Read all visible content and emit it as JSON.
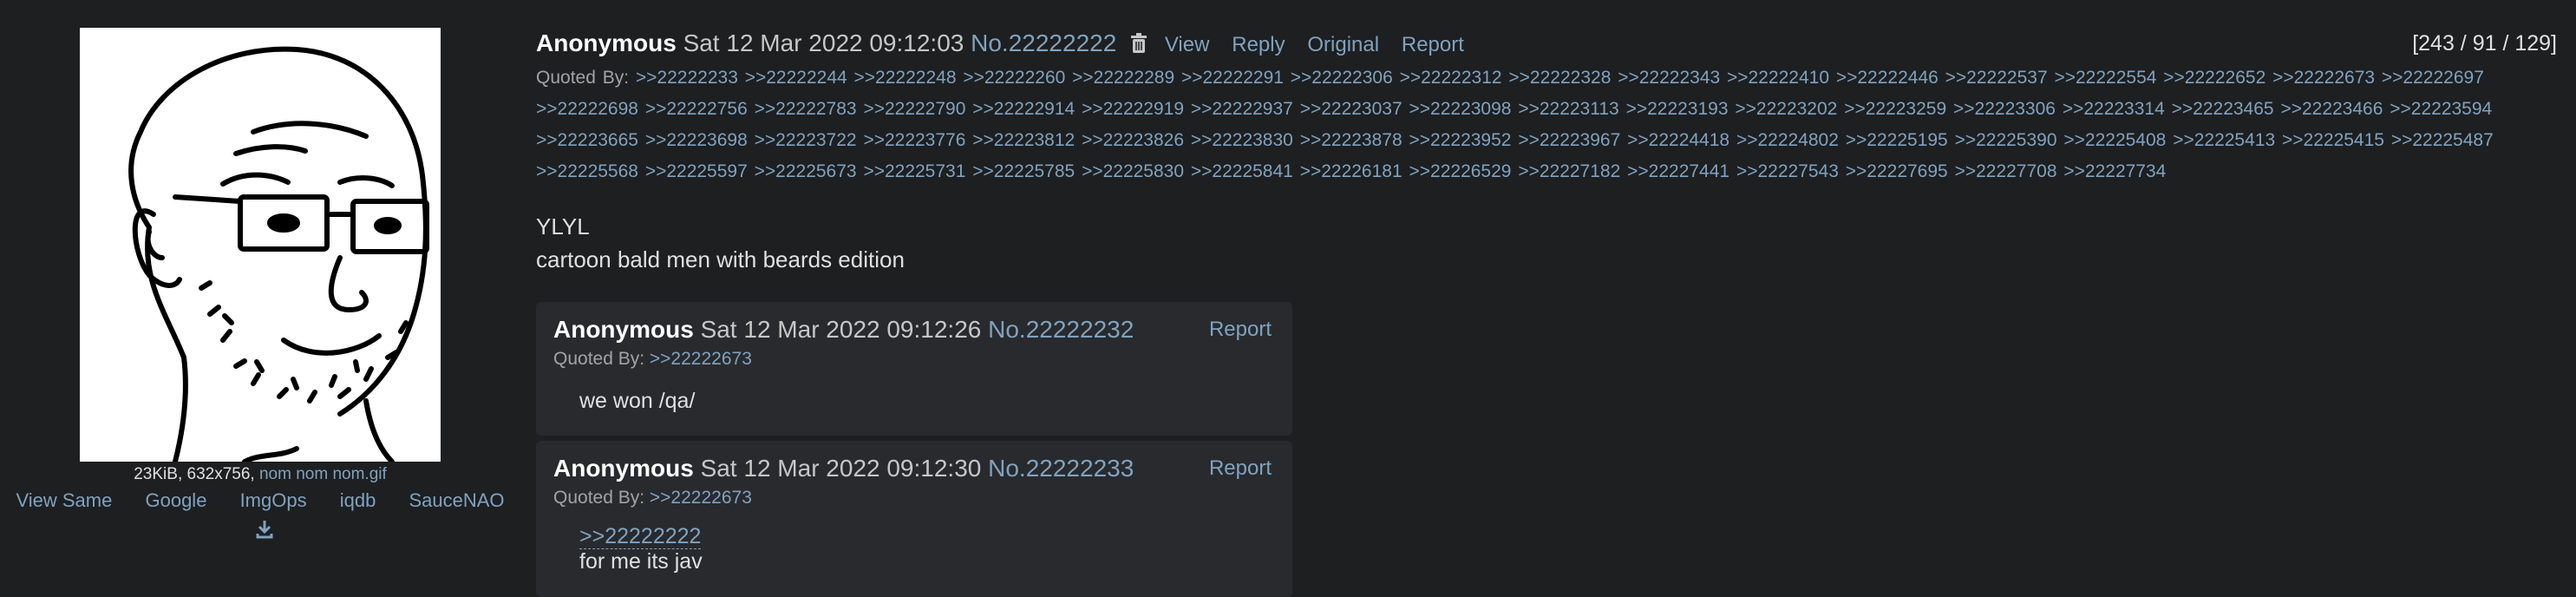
{
  "thumbnail": {
    "size": "23KiB",
    "dims": "632x756",
    "filename": "nom nom nom.gif",
    "links": [
      "View Same",
      "Google",
      "ImgOps",
      "iqdb",
      "SauceNAO"
    ]
  },
  "op": {
    "name": "Anonymous",
    "date": "Sat 12 Mar 2022 09:12:03",
    "post_no": "No.22222222",
    "actions": [
      "View",
      "Reply",
      "Original",
      "Report"
    ],
    "counts": "[243 / 91 / 129]",
    "quoted_by_label": "Quoted By:",
    "quoted_by": [
      ">>22222233",
      ">>22222244",
      ">>22222248",
      ">>22222260",
      ">>22222289",
      ">>22222291",
      ">>22222306",
      ">>22222312",
      ">>22222328",
      ">>22222343",
      ">>22222410",
      ">>22222446",
      ">>22222537",
      ">>22222554",
      ">>22222652",
      ">>22222673",
      ">>22222697",
      ">>22222698",
      ">>22222756",
      ">>22222783",
      ">>22222790",
      ">>22222914",
      ">>22222919",
      ">>22222937",
      ">>22223037",
      ">>22223098",
      ">>22223113",
      ">>22223193",
      ">>22223202",
      ">>22223259",
      ">>22223306",
      ">>22223314",
      ">>22223465",
      ">>22223466",
      ">>22223594",
      ">>22223665",
      ">>22223698",
      ">>22223722",
      ">>22223776",
      ">>22223812",
      ">>22223826",
      ">>22223830",
      ">>22223878",
      ">>22223952",
      ">>22223967",
      ">>22224418",
      ">>22224802",
      ">>22225195",
      ">>22225390",
      ">>22225408",
      ">>22225413",
      ">>22225415",
      ">>22225487",
      ">>22225568",
      ">>22225597",
      ">>22225673",
      ">>22225731",
      ">>22225785",
      ">>22225830",
      ">>22225841",
      ">>22226181",
      ">>22226529",
      ">>22227182",
      ">>22227441",
      ">>22227543",
      ">>22227695",
      ">>22227708",
      ">>22227734"
    ],
    "title": "YLYL",
    "body": "cartoon bald men with beards edition"
  },
  "replies": [
    {
      "name": "Anonymous",
      "date": "Sat 12 Mar 2022 09:12:26",
      "post_no": "No.22222232",
      "action": "Report",
      "quoted_by_label": "Quoted By:",
      "quoted_by": ">>22222673",
      "text": "we won /qa/"
    },
    {
      "name": "Anonymous",
      "date": "Sat 12 Mar 2022 09:12:30",
      "post_no": "No.22222233",
      "action": "Report",
      "quoted_by_label": "Quoted By:",
      "quoted_by": ">>22222673",
      "quote_link": ">>22222222",
      "text": "for me its jav"
    }
  ],
  "colors": {
    "background": "#1d1f21",
    "reply_bg": "#282a2e",
    "link": "#81a2be",
    "name": "#ffffff"
  },
  "icons": [
    "trash-icon",
    "download-icon"
  ]
}
